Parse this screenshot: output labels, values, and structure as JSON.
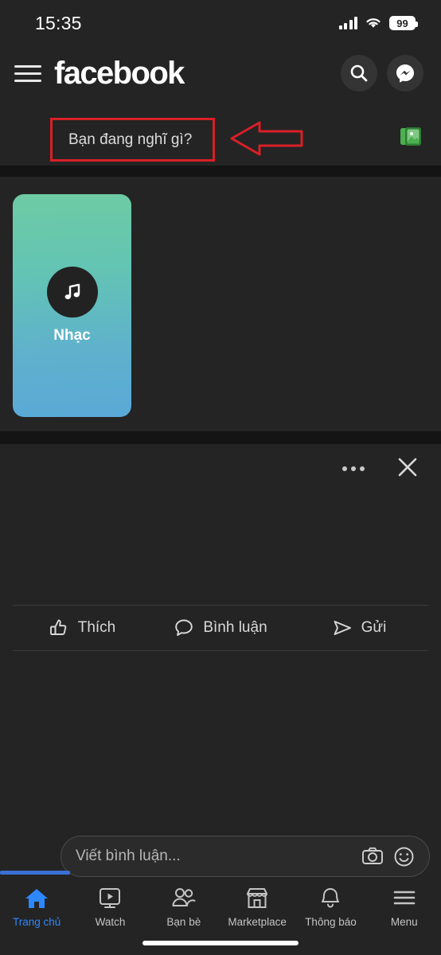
{
  "status_bar": {
    "time": "15:35",
    "signal_icon": "signal-bars-icon",
    "wifi_icon": "wifi-icon",
    "battery_level": "99"
  },
  "header": {
    "menu_icon": "hamburger-menu-icon",
    "brand": "facebook",
    "search_icon": "search-icon",
    "messenger_icon": "messenger-icon"
  },
  "composer": {
    "placeholder": "Bạn đang nghĩ gì?",
    "photo_icon": "photo-gallery-icon",
    "annotation_arrow": "red-left-arrow-annotation",
    "annotation_color": "#d91f26"
  },
  "stories": {
    "cards": [
      {
        "label": "Nhạc",
        "icon": "music-note-icon",
        "gradient_from": "#6ecba4",
        "gradient_to": "#5aa9d8"
      }
    ]
  },
  "post": {
    "more_icon": "more-options-icon",
    "close_icon": "close-icon",
    "actions": [
      {
        "label": "Thích",
        "icon": "thumbs-up-icon"
      },
      {
        "label": "Bình luận",
        "icon": "comment-bubble-icon"
      },
      {
        "label": "Gửi",
        "icon": "send-arrow-icon"
      }
    ]
  },
  "comment_bar": {
    "placeholder": "Viết bình luận...",
    "camera_icon": "camera-icon",
    "emoji_icon": "emoji-smiley-icon"
  },
  "bottom_nav": {
    "active_color": "#2d88ff",
    "items": [
      {
        "label": "Trang chủ",
        "icon": "home-icon",
        "active": true
      },
      {
        "label": "Watch",
        "icon": "watch-play-icon",
        "active": false
      },
      {
        "label": "Bạn bè",
        "icon": "friends-icon",
        "active": false
      },
      {
        "label": "Marketplace",
        "icon": "marketplace-store-icon",
        "active": false
      },
      {
        "label": "Thông báo",
        "icon": "bell-notification-icon",
        "active": false
      },
      {
        "label": "Menu",
        "icon": "menu-lines-icon",
        "active": false
      }
    ]
  }
}
